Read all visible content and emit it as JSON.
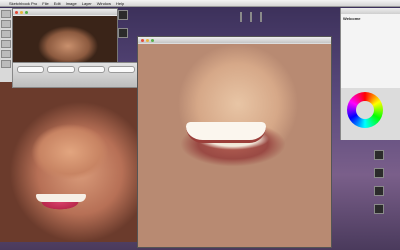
{
  "menubar": {
    "items": [
      "",
      "Sketchbook Pro",
      "File",
      "Edit",
      "Image",
      "Layer",
      "Window",
      "Help"
    ],
    "right": [
      "",
      "",
      ""
    ]
  },
  "image_window": {
    "title": ""
  },
  "controls": {
    "labels": [
      "",
      "",
      "",
      ""
    ]
  },
  "paint_window": {
    "title": ""
  },
  "info_panel": {
    "title": "Welcome",
    "body": ""
  },
  "colors": {
    "desktop_top": "#3a2f58",
    "desktop_mid": "#5b4a7e"
  }
}
